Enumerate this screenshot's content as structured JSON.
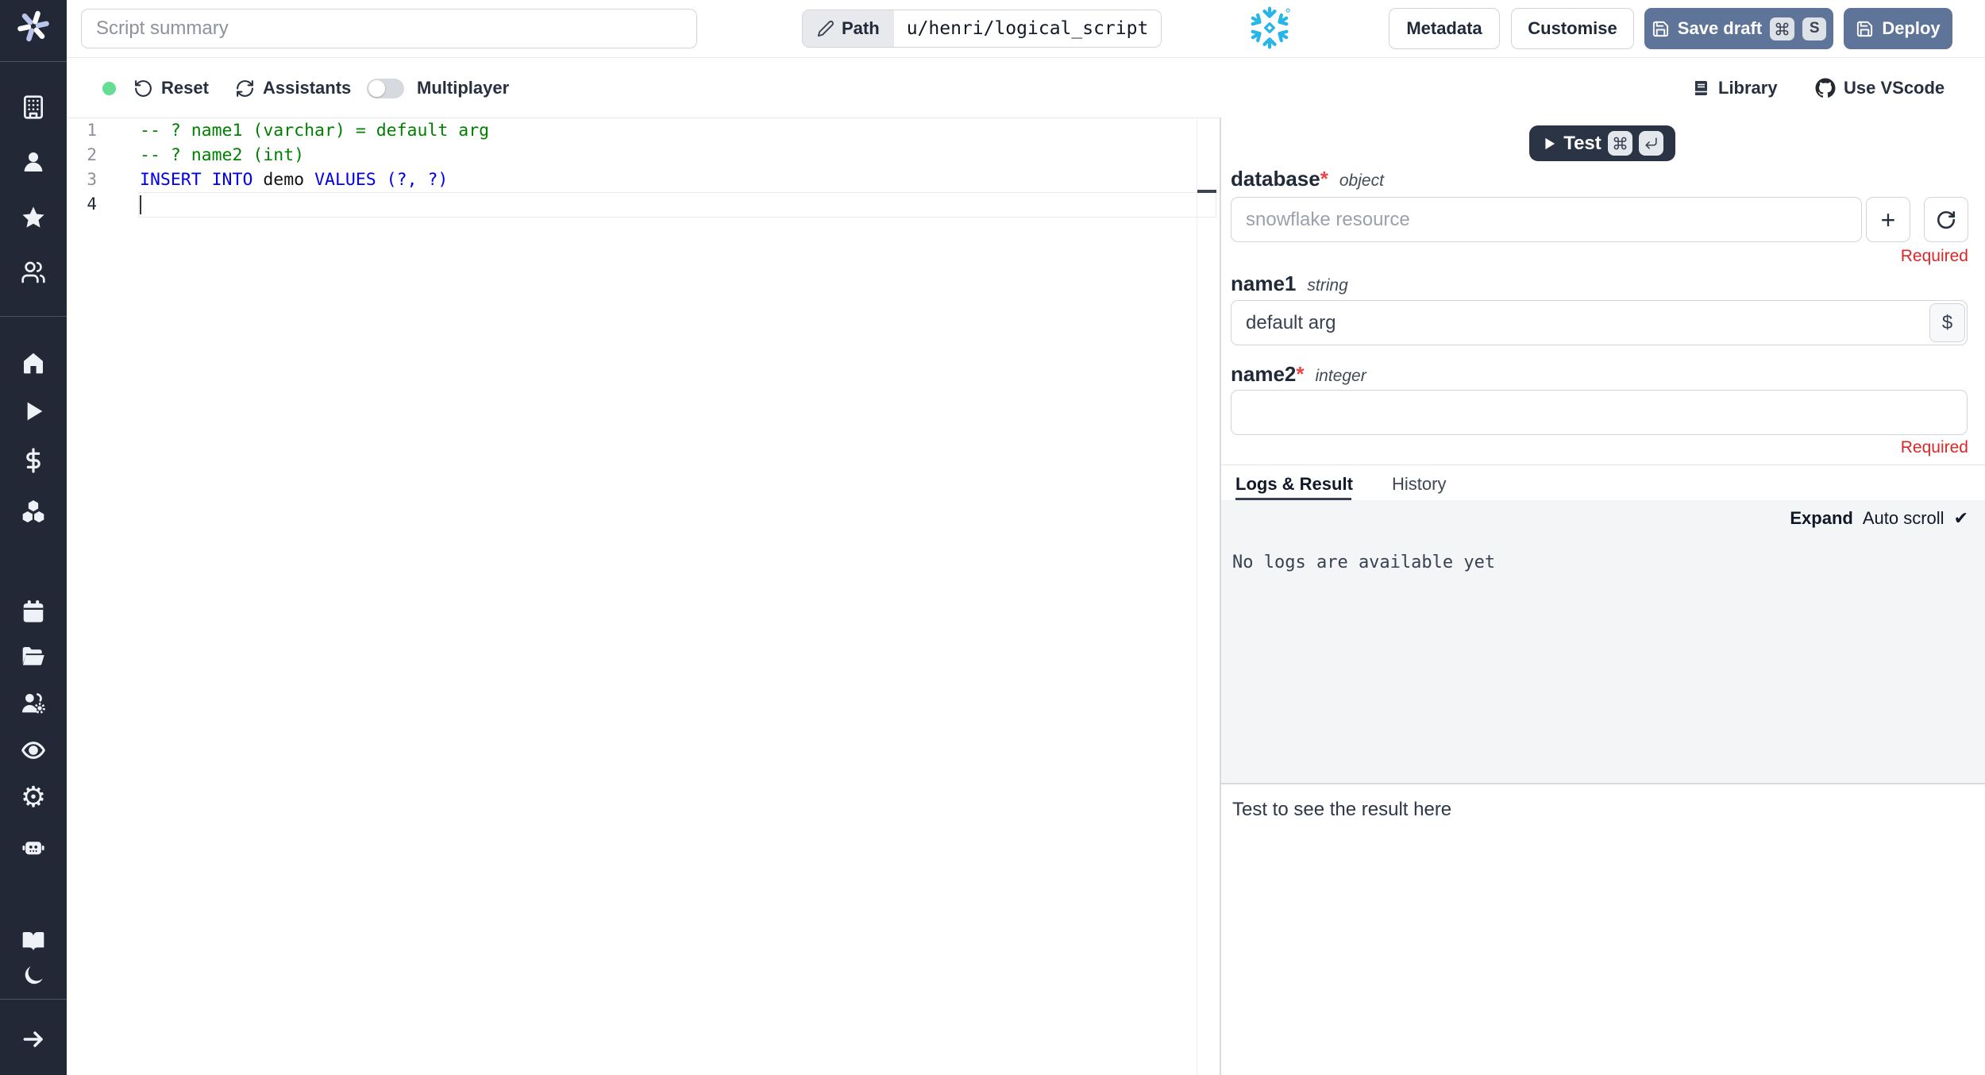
{
  "colors": {
    "sidebar_bg": "#222836",
    "primary_button": "#5f7499",
    "test_button": "#2b3444",
    "snowflake_blue": "#29b5e8",
    "required_red": "#dc2626",
    "green_status_dot": "#63de93",
    "code_comment": "#008000",
    "code_keyword": "#0000ee"
  },
  "topbar": {
    "summary_placeholder": "Script summary",
    "path_label": "Path",
    "path_value": "u/henri/logical_script",
    "metadata": "Metadata",
    "customise": "Customise",
    "save_draft": "Save draft",
    "save_shortcut_key": "S",
    "deploy": "Deploy"
  },
  "toolbar": {
    "reset": "Reset",
    "assistants": "Assistants",
    "multiplayer": "Multiplayer",
    "library": "Library",
    "use_vscode": "Use VScode"
  },
  "sidebar": {
    "icons": [
      "windmill-logo-icon",
      "building-icon",
      "user-icon",
      "star-icon",
      "users-icon",
      "home-icon",
      "play-icon",
      "dollar-icon",
      "boxes-icon",
      "calendar-icon",
      "folder-open-icon",
      "users-gear-icon",
      "eye-icon",
      "gear-icon",
      "bot-icon",
      "book-open-icon",
      "moon-icon",
      "arrow-right-icon"
    ]
  },
  "editor": {
    "lines": [
      {
        "num": "1",
        "tokens": [
          {
            "t": "-- ? name1 (varchar) = default arg",
            "c": "comment"
          }
        ]
      },
      {
        "num": "2",
        "tokens": [
          {
            "t": "-- ? name2 (int)",
            "c": "comment"
          }
        ]
      },
      {
        "num": "3",
        "tokens": [
          {
            "t": "INSERT INTO",
            "c": "keyword"
          },
          {
            "t": " demo ",
            "c": "plain"
          },
          {
            "t": "VALUES",
            "c": "keyword"
          },
          {
            "t": " (?, ?)",
            "c": "keyword"
          }
        ]
      },
      {
        "num": "4",
        "tokens": []
      }
    ],
    "active_line": "4"
  },
  "panel": {
    "test_label": "Test",
    "fields": {
      "database": {
        "label": "database",
        "star": "*",
        "type": "object",
        "placeholder": "snowflake resource"
      },
      "name1": {
        "label": "name1",
        "type": "string",
        "value": "default arg",
        "dollar": "$"
      },
      "name2": {
        "label": "name2",
        "star": "*",
        "type": "integer"
      }
    },
    "required_text": "Required",
    "tabs": {
      "logs": "Logs & Result",
      "history": "History"
    },
    "logs": {
      "expand": "Expand",
      "autoscroll": "Auto scroll",
      "check": "✔",
      "empty": "No logs are available yet"
    },
    "result_hint": "Test to see the result here"
  }
}
